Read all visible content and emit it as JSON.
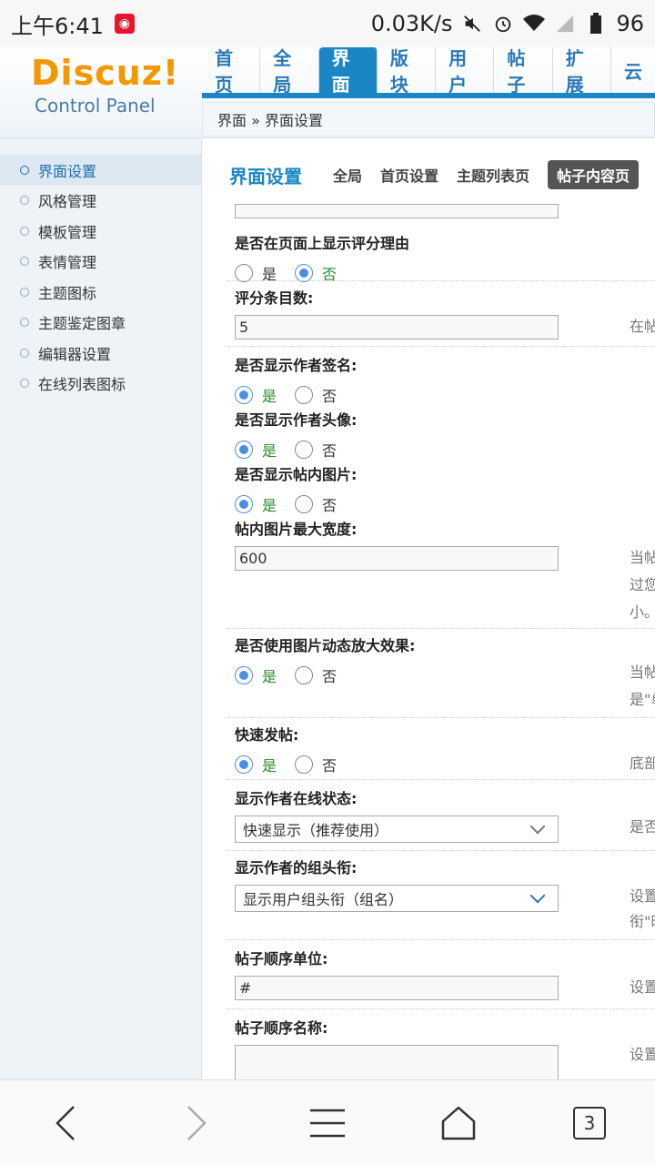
{
  "status_bar": {
    "time": "上午6:41",
    "net_speed": "0.03K/s",
    "battery": "96"
  },
  "header": {
    "logo_text": "Discuz!",
    "logo_sub": "Control Panel",
    "nav": [
      "首页",
      "全局",
      "界面",
      "版块",
      "用户",
      "帖子",
      "扩展",
      "云"
    ],
    "breadcrumb": "界面 » 界面设置"
  },
  "sidebar": {
    "items": [
      "界面设置",
      "风格管理",
      "模板管理",
      "表情管理",
      "主题图标",
      "主题鉴定图章",
      "编辑器设置",
      "在线列表图标"
    ]
  },
  "content": {
    "title": "界面设置",
    "subtabs": [
      "全局",
      "首页设置",
      "主题列表页",
      "帖子内容页"
    ],
    "radio_yes": "是",
    "radio_no": "否",
    "fields": {
      "show_rate_reason": "是否在页面上显示评分理由",
      "rate_count": "评分条目数:",
      "rate_count_value": "5",
      "rate_count_tip": "在帖",
      "show_signature": "是否显示作者签名:",
      "show_avatar": "是否显示作者头像:",
      "show_images": "是否显示帖内图片:",
      "image_max_width": "帖内图片最大宽度:",
      "image_max_width_value": "600",
      "image_max_width_tip1": "当帖",
      "image_max_width_tip2": "过您",
      "image_max_width_tip3": "小。",
      "zoom_effect": "是否使用图片动态放大效果:",
      "zoom_tip1": "当帖",
      "zoom_tip2": "是\"单",
      "quick_post": "快速发帖:",
      "quick_post_tip": "底部",
      "online_status": "显示作者在线状态:",
      "online_status_value": "快速显示（推荐使用）",
      "online_status_tip": "是否",
      "group_title": "显示作者的组头衔:",
      "group_title_value": "显示用户组头衔（组名）",
      "group_title_tip1": "设置",
      "group_title_tip2": "衔\"时",
      "post_order_unit": "帖子顺序单位:",
      "post_order_unit_value": "#",
      "post_order_unit_tip": "设置",
      "post_order_name": "帖子顺序名称:",
      "post_order_name_tip": "设置"
    }
  },
  "bottom_nav": {
    "tabs_count": "3"
  },
  "colors": {
    "accent": "#1a86c4",
    "logo": "#f39800",
    "radio": "#4a90e2"
  }
}
